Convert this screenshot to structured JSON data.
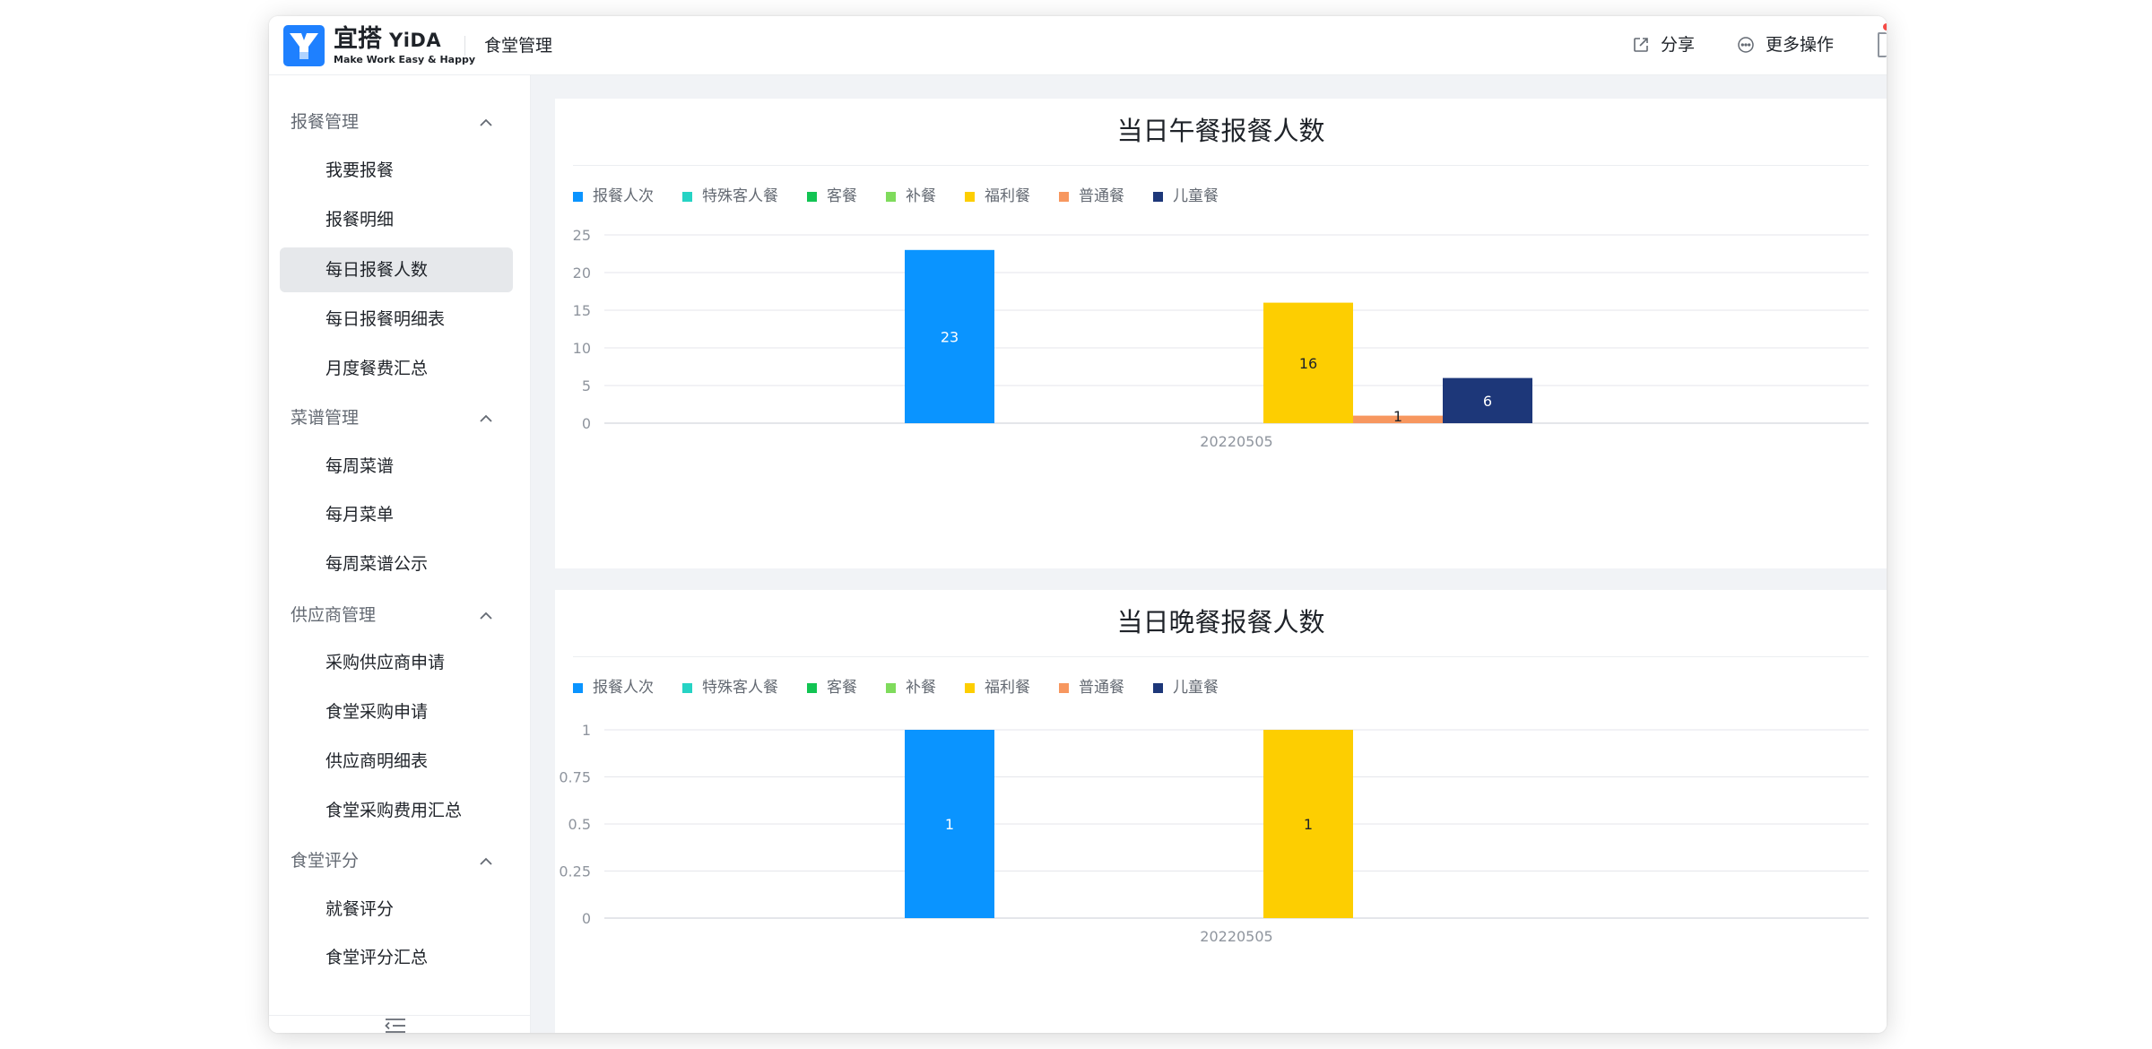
{
  "header": {
    "logo_cn": "宜搭",
    "logo_en": "YiDA",
    "logo_sub": "Make Work Easy & Happy",
    "app_name": "食堂管理",
    "share_label": "分享",
    "more_label": "更多操作",
    "share_icon": "share-icon",
    "more_icon": "more-icon"
  },
  "sidebar": {
    "groups": [
      {
        "label": "报餐管理",
        "items": [
          "我要报餐",
          "报餐明细",
          "每日报餐人数",
          "每日报餐明细表",
          "月度餐费汇总"
        ]
      },
      {
        "label": "菜谱管理",
        "items": [
          "每周菜谱",
          "每月菜单",
          "每周菜谱公示"
        ]
      },
      {
        "label": "供应商管理",
        "items": [
          "采购供应商申请",
          "食堂采购申请",
          "供应商明细表",
          "食堂采购费用汇总"
        ]
      },
      {
        "label": "食堂评分",
        "items": [
          "就餐评分",
          "食堂评分汇总"
        ]
      }
    ],
    "active_item": "每日报餐人数",
    "collapse_icon": "collapse-sidebar-icon"
  },
  "colors": {
    "brand": "#1e80ff",
    "active_bg": "#e6e8eb"
  },
  "chart_data": [
    {
      "type": "bar",
      "title": "当日午餐报餐人数",
      "categories": [
        "20220505"
      ],
      "ylim": [
        0,
        25
      ],
      "yticks": [
        "0",
        "5",
        "10",
        "15",
        "20",
        "25"
      ],
      "grid": true,
      "legend_position": "top-left",
      "series": [
        {
          "name": "报餐人次",
          "color": "#0a94ff",
          "values": [
            23
          ]
        },
        {
          "name": "特殊客人餐",
          "color": "#26d3c4",
          "values": [
            0
          ]
        },
        {
          "name": "客餐",
          "color": "#12c453",
          "values": [
            0
          ]
        },
        {
          "name": "补餐",
          "color": "#7fdb5c",
          "values": [
            0
          ]
        },
        {
          "name": "福利餐",
          "color": "#fdce01",
          "values": [
            16
          ]
        },
        {
          "name": "普通餐",
          "color": "#f7975f",
          "values": [
            1
          ]
        },
        {
          "name": "儿童餐",
          "color": "#1d3779",
          "values": [
            6
          ]
        }
      ]
    },
    {
      "type": "bar",
      "title": "当日晚餐报餐人数",
      "categories": [
        "20220505"
      ],
      "ylim": [
        0,
        1
      ],
      "yticks": [
        "0",
        "0.25",
        "0.5",
        "0.75",
        "1"
      ],
      "grid": true,
      "legend_position": "top-left",
      "series": [
        {
          "name": "报餐人次",
          "color": "#0a94ff",
          "values": [
            1
          ]
        },
        {
          "name": "特殊客人餐",
          "color": "#26d3c4",
          "values": [
            0
          ]
        },
        {
          "name": "客餐",
          "color": "#12c453",
          "values": [
            0
          ]
        },
        {
          "name": "补餐",
          "color": "#7fdb5c",
          "values": [
            0
          ]
        },
        {
          "name": "福利餐",
          "color": "#fdce01",
          "values": [
            1
          ]
        },
        {
          "name": "普通餐",
          "color": "#f7975f",
          "values": [
            0
          ]
        },
        {
          "name": "儿童餐",
          "color": "#1d3779",
          "values": [
            0
          ]
        }
      ]
    }
  ]
}
